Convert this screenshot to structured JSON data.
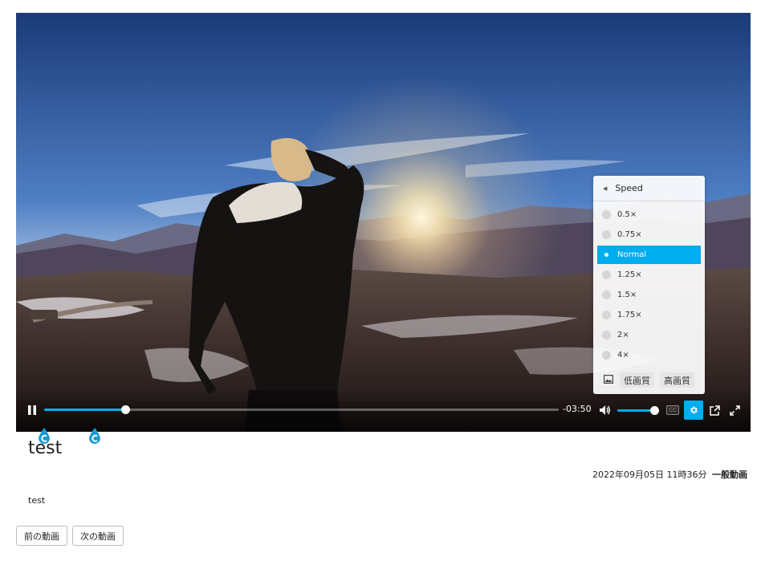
{
  "player": {
    "progress_fraction": 0.158,
    "remaining_time": "-03:50",
    "volume_fraction": 1.0,
    "cc_label": "CC",
    "accent_color": "#00adef",
    "icons": {
      "pause": "pause-icon",
      "volume": "volume-icon",
      "cc": "closed-captions-icon",
      "settings": "gear-icon",
      "popout": "external-link-icon",
      "fullscreen": "fullscreen-icon"
    }
  },
  "speed_menu": {
    "header": "Speed",
    "options": [
      {
        "label": "0.5×",
        "selected": false
      },
      {
        "label": "0.75×",
        "selected": false
      },
      {
        "label": "Normal",
        "selected": true
      },
      {
        "label": "1.25×",
        "selected": false
      },
      {
        "label": "1.5×",
        "selected": false
      },
      {
        "label": "1.75×",
        "selected": false
      },
      {
        "label": "2×",
        "selected": false
      },
      {
        "label": "4×",
        "selected": false
      }
    ],
    "quality": {
      "low": "低画質",
      "high": "高画質"
    }
  },
  "video_info": {
    "title": "test",
    "date": "2022年09月05日 11時36分",
    "category": "一般動画",
    "description": "test"
  },
  "navigation": {
    "prev_label": "前の動画",
    "next_label": "次の動画"
  }
}
